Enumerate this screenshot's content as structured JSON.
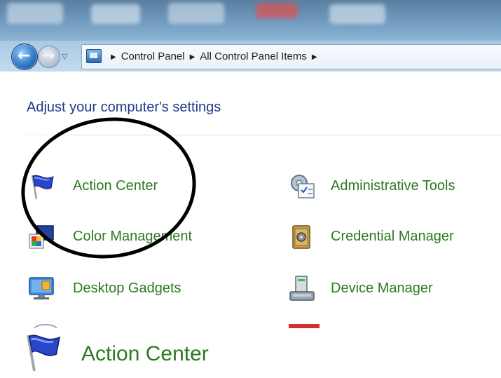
{
  "address_bar": {
    "breadcrumbs": [
      "Control Panel",
      "All Control Panel Items"
    ]
  },
  "content": {
    "heading": "Adjust your computer's settings",
    "items": [
      {
        "label": "Action Center",
        "icon": "flag-icon"
      },
      {
        "label": "Administrative Tools",
        "icon": "admin-tools-icon"
      },
      {
        "label": "Color Management",
        "icon": "color-management-icon"
      },
      {
        "label": "Credential Manager",
        "icon": "safe-icon"
      },
      {
        "label": "Desktop Gadgets",
        "icon": "gadgets-icon"
      },
      {
        "label": "Device Manager",
        "icon": "device-manager-icon"
      }
    ]
  },
  "zoom_callout": {
    "label": "Action Center",
    "icon": "flag-icon"
  },
  "colors": {
    "link_green": "#2b7a1f",
    "heading_blue": "#1e3a8a",
    "annotation": "#000000"
  }
}
